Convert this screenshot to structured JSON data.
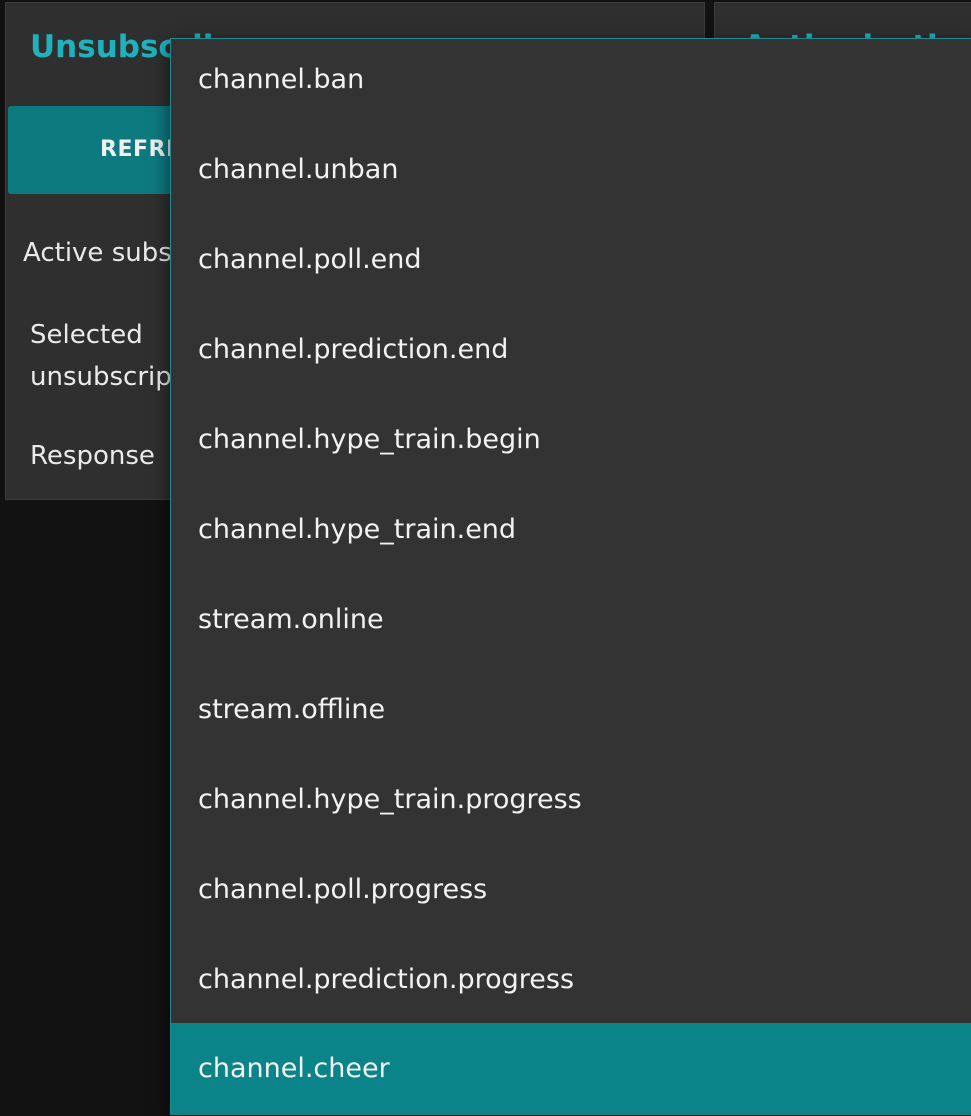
{
  "left_panel": {
    "title": "Unsubscribe",
    "refresh_label": "REFRESH",
    "active_label": "Active subscriptions",
    "selected_label_line1": "Selected",
    "selected_label_line2": "unsubscription",
    "response_label": "Response"
  },
  "right_panel": {
    "title": "Authorization"
  },
  "dropdown": {
    "items": [
      "channel.ban",
      "channel.unban",
      "channel.poll.end",
      "channel.prediction.end",
      "channel.hype_train.begin",
      "channel.hype_train.end",
      "stream.online",
      "stream.offline",
      "channel.hype_train.progress",
      "channel.poll.progress",
      "channel.prediction.progress",
      "channel.cheer"
    ],
    "selected": "channel.cheer"
  },
  "colors": {
    "accent": "#1fb2bd",
    "button": "#0d7a80",
    "selected_item": "#0b8489",
    "panel_bg": "#2f2f2f",
    "dropdown_bg": "#333333",
    "page_bg": "#121212"
  }
}
